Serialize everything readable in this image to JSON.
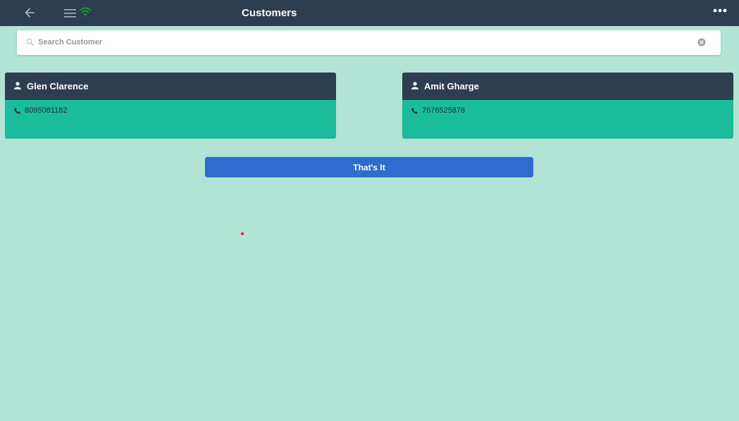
{
  "header": {
    "title": "Customers"
  },
  "search": {
    "placeholder": "Search Customer",
    "value": ""
  },
  "customers": [
    {
      "name": "Glen Clarence",
      "phone": "8095081182"
    },
    {
      "name": "Amit Gharge",
      "phone": "7676525878"
    }
  ],
  "actions": {
    "confirm_label": "That's It"
  },
  "colors": {
    "header_bg": "#2d3e50",
    "page_bg": "#b3e3d5",
    "card_body": "#1bbc9c",
    "button": "#2e6dce"
  },
  "icons": [
    "back-arrow-icon",
    "hamburger-menu-icon",
    "wifi-icon",
    "more-dots-icon",
    "search-icon",
    "clear-icon",
    "person-icon",
    "phone-icon"
  ]
}
